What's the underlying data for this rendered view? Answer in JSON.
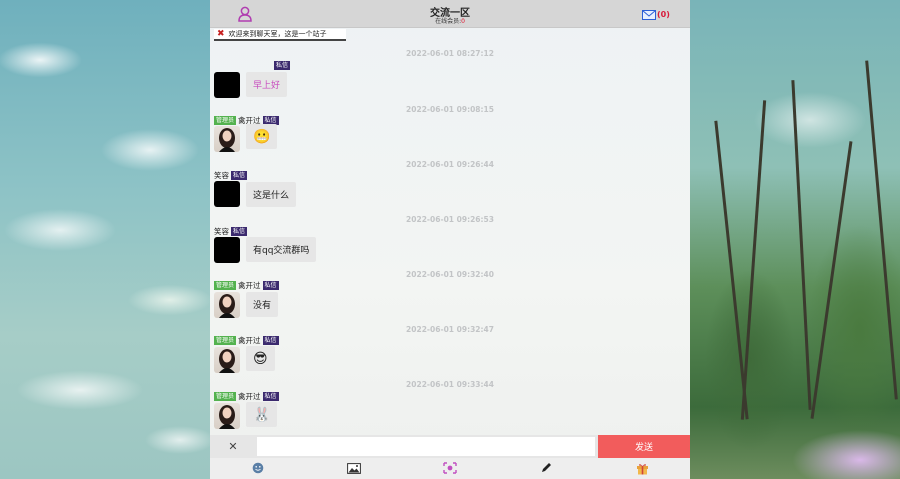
{
  "header": {
    "title": "交流一区",
    "online_label": "在线会员:",
    "online_count": "0",
    "mail_count": "(0)"
  },
  "notice": {
    "text": "欢迎来到聊天室，这是一个站子"
  },
  "messages": [
    {
      "time": "2022-06-01 08:27:12",
      "role": "",
      "nick": "",
      "priv": "私信",
      "content": "早上好",
      "avatar": "black",
      "style": "pink"
    },
    {
      "time": "2022-06-01 09:08:15",
      "role": "管理员",
      "nick": "禽开过",
      "priv": "私信",
      "content": "😬",
      "avatar": "girl",
      "style": "emoji"
    },
    {
      "time": "2022-06-01 09:26:44",
      "role": "",
      "nick": "笑容",
      "priv": "私信",
      "content": "这是什么",
      "avatar": "black",
      "style": "text"
    },
    {
      "time": "2022-06-01 09:26:53",
      "role": "",
      "nick": "笑容",
      "priv": "私信",
      "content": "有qq交流群吗",
      "avatar": "black",
      "style": "text"
    },
    {
      "time": "2022-06-01 09:32:40",
      "role": "管理员",
      "nick": "禽开过",
      "priv": "私信",
      "content": "没有",
      "avatar": "girl",
      "style": "text"
    },
    {
      "time": "2022-06-01 09:32:47",
      "role": "管理员",
      "nick": "禽开过",
      "priv": "私信",
      "content": "😎",
      "avatar": "girl",
      "style": "emoji"
    },
    {
      "time": "2022-06-01 09:33:44",
      "role": "管理员",
      "nick": "禽开过",
      "priv": "私信",
      "content": "🐰",
      "avatar": "girl",
      "style": "emoji"
    }
  ],
  "input": {
    "close_symbol": "✕",
    "value": "",
    "send_label": "发送"
  },
  "toolbar": {
    "icons": [
      "smile-icon",
      "image-icon",
      "sticker-icon",
      "pen-icon",
      "gift-icon"
    ]
  },
  "colors": {
    "send_button": "#f25c5c",
    "role_badge": "#54b24f",
    "priv_badge": "#3b2a6e",
    "mail_count": "#d81b3b",
    "pink_text": "#c84bbf"
  }
}
